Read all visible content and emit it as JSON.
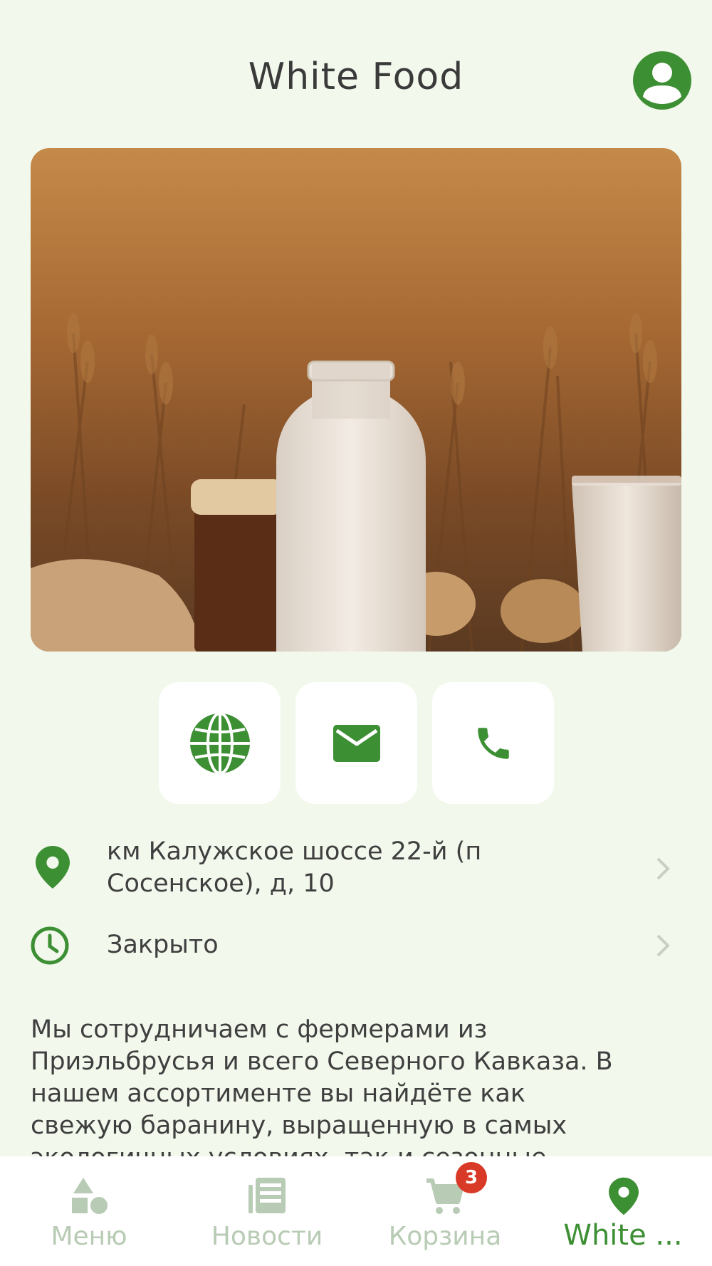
{
  "header": {
    "title": "White Food",
    "profile_icon": "account-circle-icon"
  },
  "hero": {
    "image": "milk-bottle-wheat-field-photo"
  },
  "contacts": [
    {
      "icon": "globe-icon"
    },
    {
      "icon": "mail-icon"
    },
    {
      "icon": "phone-icon"
    }
  ],
  "info": {
    "address_line1": "км Калужское шоссе 22-й (п",
    "address_line2": "Сосенское), д, 10",
    "hours": "Закрыто"
  },
  "description": {
    "line1": "Мы сотрудничаем с фермерами из",
    "line2": "Приэльбрусья и всего Северного Кавказа. В",
    "line3": "нашем ассортименте вы найдёте как",
    "line4": "свежую баранину, выращенную в самых",
    "line5": "экологичных условиях, так и сезонные"
  },
  "nav": {
    "items": [
      {
        "label": "Меню",
        "icon": "shapes-icon"
      },
      {
        "label": "Новости",
        "icon": "newspaper-icon"
      },
      {
        "label": "Корзина",
        "icon": "cart-icon",
        "badge": "3"
      },
      {
        "label": "White ...",
        "icon": "location-pin-icon"
      }
    ],
    "active_index": 3
  },
  "colors": {
    "accent": "#3d8f33",
    "background": "#f2f8ec",
    "inactive": "#b8cbb4",
    "badge": "#d93a28"
  }
}
